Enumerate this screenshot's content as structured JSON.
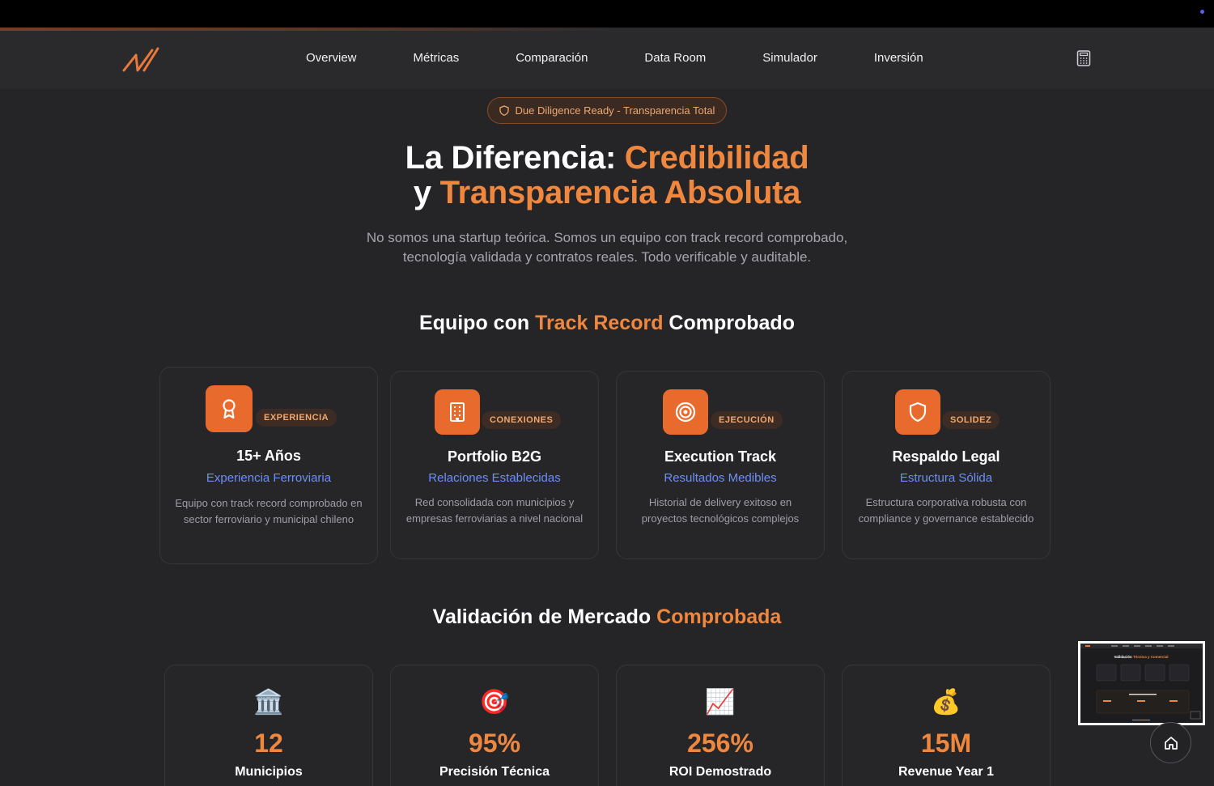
{
  "nav": {
    "items": [
      "Overview",
      "Métricas",
      "Comparación",
      "Data Room",
      "Simulador",
      "Inversión"
    ],
    "accent_color": "#f0873e"
  },
  "badge": {
    "label": "Due Diligence Ready - Transparencia Total"
  },
  "hero": {
    "title_part1": "La Diferencia: ",
    "title_accent1": "Credibilidad",
    "title_part2": "y ",
    "title_accent2": "Transparencia Absoluta",
    "subtitle": "No somos una startup teórica. Somos un equipo con track record comprobado, tecnología validada y contratos reales. Todo verificable y auditable."
  },
  "team_section": {
    "title_before": "Equipo con ",
    "title_accent": "Track Record",
    "title_after": " Comprobado",
    "cards": [
      {
        "icon": "award-icon",
        "tag": "EXPERIENCIA",
        "title": "15+ Años",
        "subtitle": "Experiencia Ferroviaria",
        "description": "Equipo con track record comprobado en sector ferroviario y municipal chileno"
      },
      {
        "icon": "building-icon",
        "tag": "CONEXIONES",
        "title": "Portfolio B2G",
        "subtitle": "Relaciones Establecidas",
        "description": "Red consolidada con municipios y empresas ferroviarias a nivel nacional"
      },
      {
        "icon": "target-icon",
        "tag": "EJECUCIÓN",
        "title": "Execution Track",
        "subtitle": "Resultados Medibles",
        "description": "Historial de delivery exitoso en proyectos tecnológicos complejos"
      },
      {
        "icon": "shield-icon",
        "tag": "SOLIDEZ",
        "title": "Respaldo Legal",
        "subtitle": "Estructura Sólida",
        "description": "Estructura corporativa robusta con compliance y governance establecido"
      }
    ]
  },
  "market_section": {
    "title_before": "Validación de Mercado ",
    "title_accent": "Comprobada",
    "stats": [
      {
        "icon": "classical-building-icon",
        "emoji": "🏛️",
        "value": "12",
        "label": "Municipios"
      },
      {
        "icon": "direct-hit-icon",
        "emoji": "🎯",
        "value": "95%",
        "label": "Precisión Técnica"
      },
      {
        "icon": "chart-increasing-icon",
        "emoji": "📈",
        "value": "256%",
        "label": "ROI Demostrado"
      },
      {
        "icon": "money-bag-icon",
        "emoji": "💰",
        "value": "15M",
        "label": "Revenue Year 1"
      }
    ]
  },
  "preview": {
    "heading_before": "Validación ",
    "heading_accent": "Técnica y Comercial"
  }
}
